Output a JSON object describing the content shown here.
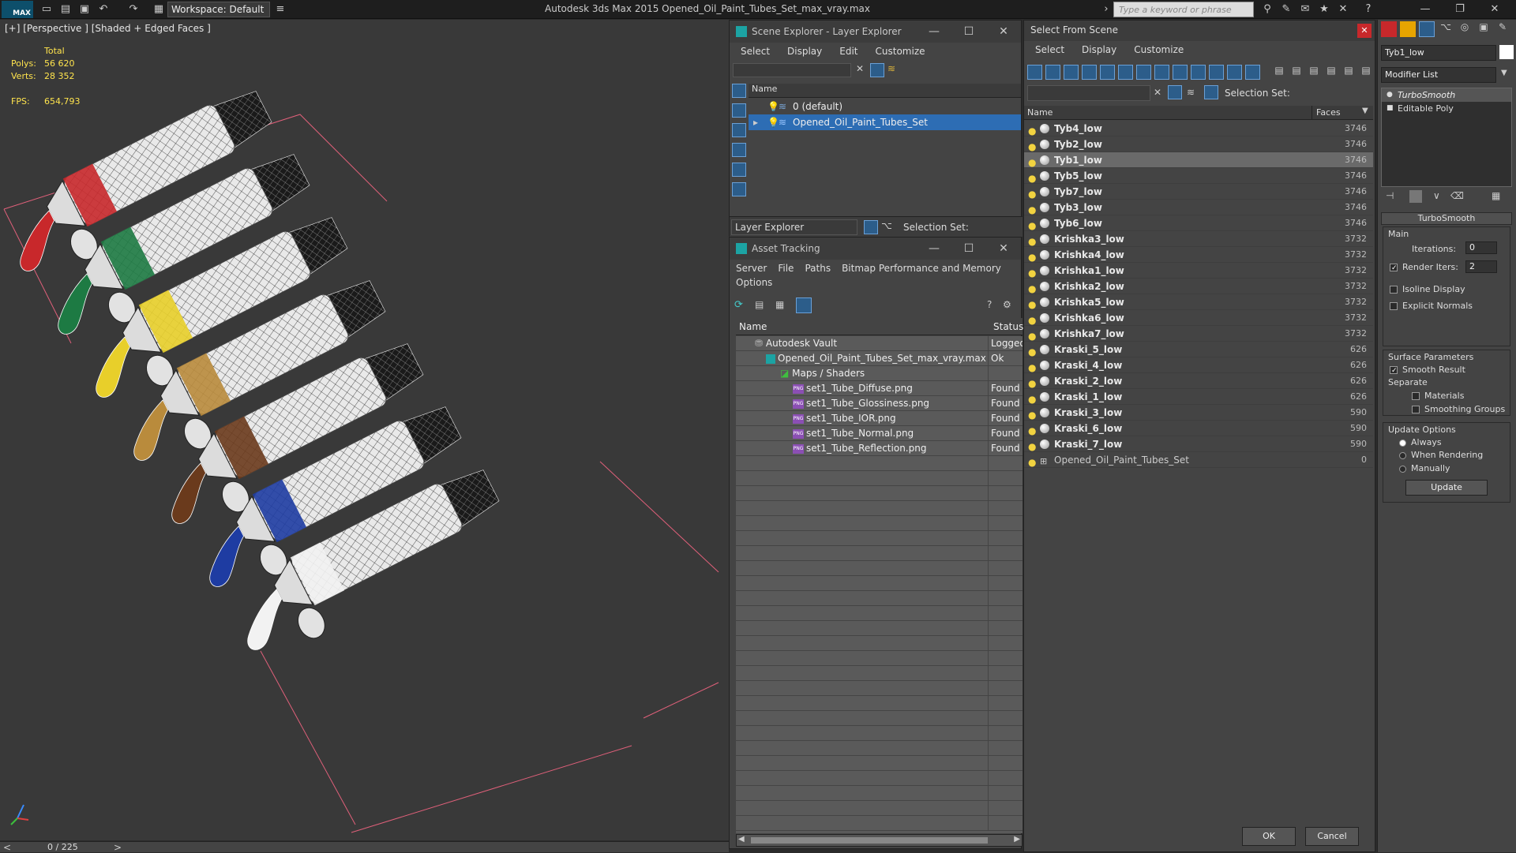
{
  "app": {
    "logo": "MAX",
    "title": "Autodesk 3ds Max  2015     Opened_Oil_Paint_Tubes_Set_max_vray.max",
    "workspace": "Workspace: Default",
    "search_placeholder": "Type a keyword or phrase"
  },
  "viewport": {
    "label": "[+] [Perspective ] [Shaded + Edged Faces ]",
    "stats": {
      "total_label": "Total",
      "polys_label": "Polys:",
      "polys_value": "56 620",
      "verts_label": "Verts:",
      "verts_value": "28 352",
      "fps_label": "FPS:",
      "fps_value": "654,793"
    },
    "tubes": [
      {
        "cap_color": "#c8282b"
      },
      {
        "cap_color": "#1d7a43"
      },
      {
        "cap_color": "#e8cf2a"
      },
      {
        "cap_color": "#b98b3c"
      },
      {
        "cap_color": "#6a3a1c"
      },
      {
        "cap_color": "#1e3ca2"
      },
      {
        "cap_color": "#f2f2f2"
      }
    ]
  },
  "timeslider": {
    "label": "0 / 225"
  },
  "scene_explorer": {
    "title": "Scene Explorer - Layer Explorer",
    "menu": [
      "Select",
      "Display",
      "Edit",
      "Customize"
    ],
    "name_header": "Name",
    "layers": [
      "0 (default)",
      "Opened_Oil_Paint_Tubes_Set"
    ],
    "footer_label": "Layer Explorer",
    "selection_set": "Selection Set:"
  },
  "asset_tracking": {
    "title": "Asset Tracking",
    "menu": [
      "Server",
      "File",
      "Paths",
      "Bitmap Performance and Memory"
    ],
    "menu2": "Options",
    "col_name": "Name",
    "col_status": "Status",
    "rows": [
      {
        "name": "Autodesk Vault",
        "status": "Logged"
      },
      {
        "name": "Opened_Oil_Paint_Tubes_Set_max_vray.max",
        "status": "Ok"
      },
      {
        "name": "Maps / Shaders",
        "status": ""
      },
      {
        "name": "set1_Tube_Diffuse.png",
        "status": "Found"
      },
      {
        "name": "set1_Tube_Glossiness.png",
        "status": "Found"
      },
      {
        "name": "set1_Tube_IOR.png",
        "status": "Found"
      },
      {
        "name": "set1_Tube_Normal.png",
        "status": "Found"
      },
      {
        "name": "set1_Tube_Reflection.png",
        "status": "Found"
      }
    ]
  },
  "select_from_scene": {
    "title": "Select From Scene",
    "menu": [
      "Select",
      "Display",
      "Customize"
    ],
    "selection_set": "Selection Set:",
    "col_name": "Name",
    "col_faces": "Faces",
    "rows": [
      {
        "name": "Tyb4_low",
        "faces": "3746"
      },
      {
        "name": "Tyb2_low",
        "faces": "3746"
      },
      {
        "name": "Tyb1_low",
        "faces": "3746"
      },
      {
        "name": "Tyb5_low",
        "faces": "3746"
      },
      {
        "name": "Tyb7_low",
        "faces": "3746"
      },
      {
        "name": "Tyb3_low",
        "faces": "3746"
      },
      {
        "name": "Tyb6_low",
        "faces": "3746"
      },
      {
        "name": "Krishka3_low",
        "faces": "3732"
      },
      {
        "name": "Krishka4_low",
        "faces": "3732"
      },
      {
        "name": "Krishka1_low",
        "faces": "3732"
      },
      {
        "name": "Krishka2_low",
        "faces": "3732"
      },
      {
        "name": "Krishka5_low",
        "faces": "3732"
      },
      {
        "name": "Krishka6_low",
        "faces": "3732"
      },
      {
        "name": "Krishka7_low",
        "faces": "3732"
      },
      {
        "name": "Kraski_5_low",
        "faces": "626"
      },
      {
        "name": "Kraski_4_low",
        "faces": "626"
      },
      {
        "name": "Kraski_2_low",
        "faces": "626"
      },
      {
        "name": "Kraski_1_low",
        "faces": "626"
      },
      {
        "name": "Kraski_3_low",
        "faces": "590"
      },
      {
        "name": "Kraski_6_low",
        "faces": "590"
      },
      {
        "name": "Kraski_7_low",
        "faces": "590"
      },
      {
        "name": "Opened_Oil_Paint_Tubes_Set",
        "faces": "0"
      }
    ],
    "ok": "OK",
    "cancel": "Cancel"
  },
  "command_panel": {
    "object_name": "Tyb1_low",
    "modifier_list": "Modifier List",
    "stack": [
      "TurboSmooth",
      "Editable Poly"
    ],
    "rollout_title": "TurboSmooth",
    "main_label": "Main",
    "iterations_label": "Iterations:",
    "iterations_value": "0",
    "render_iters_label": "Render Iters:",
    "render_iters_value": "2",
    "isoline_label": "Isoline Display",
    "explicit_normals_label": "Explicit Normals",
    "surface_params_label": "Surface Parameters",
    "smooth_result_label": "Smooth Result",
    "separate_label": "Separate",
    "materials_label": "Materials",
    "smoothing_groups_label": "Smoothing Groups",
    "update_options_label": "Update Options",
    "always_label": "Always",
    "when_rendering_label": "When Rendering",
    "manually_label": "Manually",
    "update_button": "Update"
  }
}
